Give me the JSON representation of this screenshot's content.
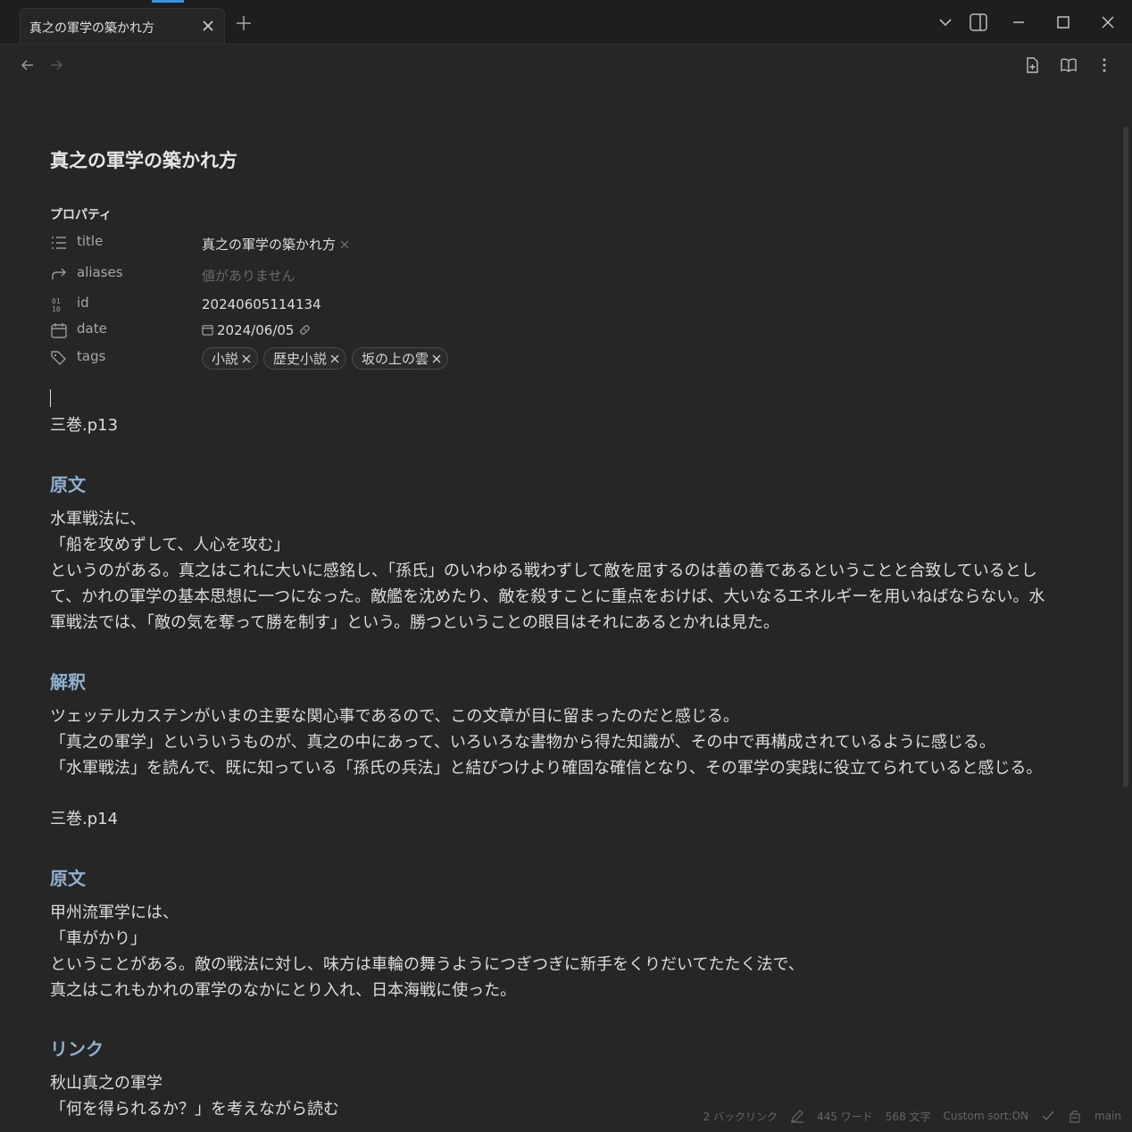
{
  "tab": {
    "title": "真之の軍学の築かれ方"
  },
  "note": {
    "title": "真之の軍学の築かれ方",
    "properties_heading": "プロパティ",
    "properties": {
      "title": {
        "key": "title",
        "value": "真之の軍学の築かれ方"
      },
      "aliases": {
        "key": "aliases",
        "placeholder": "値がありません"
      },
      "id": {
        "key": "id",
        "value": "20240605114134"
      },
      "date": {
        "key": "date",
        "value": "2024/06/05"
      },
      "tags": {
        "key": "tags",
        "values": [
          "小説",
          "歴史小説",
          "坂の上の雲"
        ]
      }
    },
    "body": {
      "page1": "三巻.p13",
      "h_original1": "原文",
      "orig1_l1": "水軍戦法に、",
      "orig1_l2": "「船を攻めずして、人心を攻む」",
      "orig1_l3": "というのがある。真之はこれに大いに感銘し、「孫氏」のいわゆる戦わずして敵を屈するのは善の善であるということと合致しているとし",
      "orig1_l4": "て、かれの軍学の基本思想に一つになった。敵艦を沈めたり、敵を殺すことに重点をおけば、大いなるエネルギーを用いねばならない。水",
      "orig1_l5": "軍戦法では、「敵の気を奪って勝を制す」という。勝つということの眼目はそれにあるとかれは見た。",
      "h_interpret": "解釈",
      "interp_l1": "ツェッテルカステンがいまの主要な関心事であるので、この文章が目に留まったのだと感じる。",
      "interp_l2": "「真之の軍学」といういうものが、真之の中にあって、いろいろな書物から得た知識が、その中で再構成されているように感じる。",
      "interp_l3": "「水軍戦法」を読んで、既に知っている「孫氏の兵法」と結びつけより確固な確信となり、その軍学の実践に役立てられていると感じる。",
      "page2": "三巻.p14",
      "h_original2": "原文",
      "orig2_l1": "甲州流軍学には、",
      "orig2_l2": "「車がかり」",
      "orig2_l3": "ということがある。敵の戦法に対し、味方は車輪の舞うようにつぎつぎに新手をくりだいてたたく法で、",
      "orig2_l4": "真之はこれもかれの軍学のなかにとり入れ、日本海戦に使った。",
      "h_link": "リンク",
      "link_l1": "秋山真之の軍学",
      "link_l2": "「何を得られるか？」を考えながら読む"
    }
  },
  "status": {
    "backlinks": "2 バックリンク",
    "words": "445 ワード",
    "chars": "568 文字",
    "sort": "Custom sort:ON",
    "branch": "main"
  },
  "colors": {
    "background": "#262626",
    "heading": "#8fb0cf",
    "accent": "#3a8ee6"
  }
}
